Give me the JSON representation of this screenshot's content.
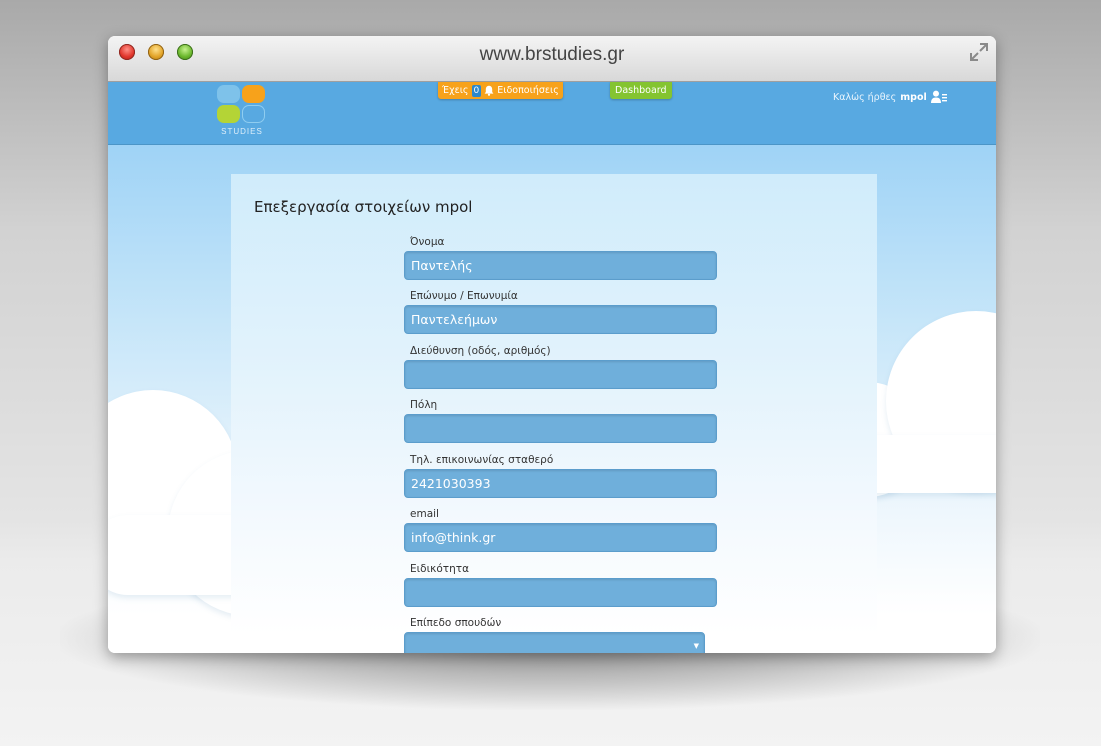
{
  "browser": {
    "url": "www.brstudies.gr"
  },
  "header": {
    "logo_text": "STUDIES",
    "notifications": {
      "prefix": "Έχεις",
      "count": "0",
      "suffix": "Ειδοποιήσεις"
    },
    "dashboard_label": "Dashboard",
    "welcome_text": "Καλώς ήρθες",
    "username": "mpol"
  },
  "form": {
    "title": "Επεξεργασία στοιχείων mpol",
    "fields": [
      {
        "label": "Όνομα",
        "value": "Παντελής"
      },
      {
        "label": "Επώνυμο / Επωνυμία",
        "value": "Παντελεήμων"
      },
      {
        "label": "Διεύθυνση (οδός, αριθμός)",
        "value": ""
      },
      {
        "label": "Πόλη",
        "value": ""
      },
      {
        "label": "Τηλ. επικοινωνίας σταθερό",
        "value": "2421030393"
      },
      {
        "label": "email",
        "value": "info@think.gr"
      },
      {
        "label": "Ειδικότητα",
        "value": ""
      },
      {
        "label": "Επίπεδο σπουδών",
        "value": ""
      }
    ]
  },
  "colors": {
    "header_blue": "#58a9e1",
    "notification_orange": "#f7a21b",
    "dashboard_green": "#84c430",
    "input_blue": "#6fafdb"
  }
}
